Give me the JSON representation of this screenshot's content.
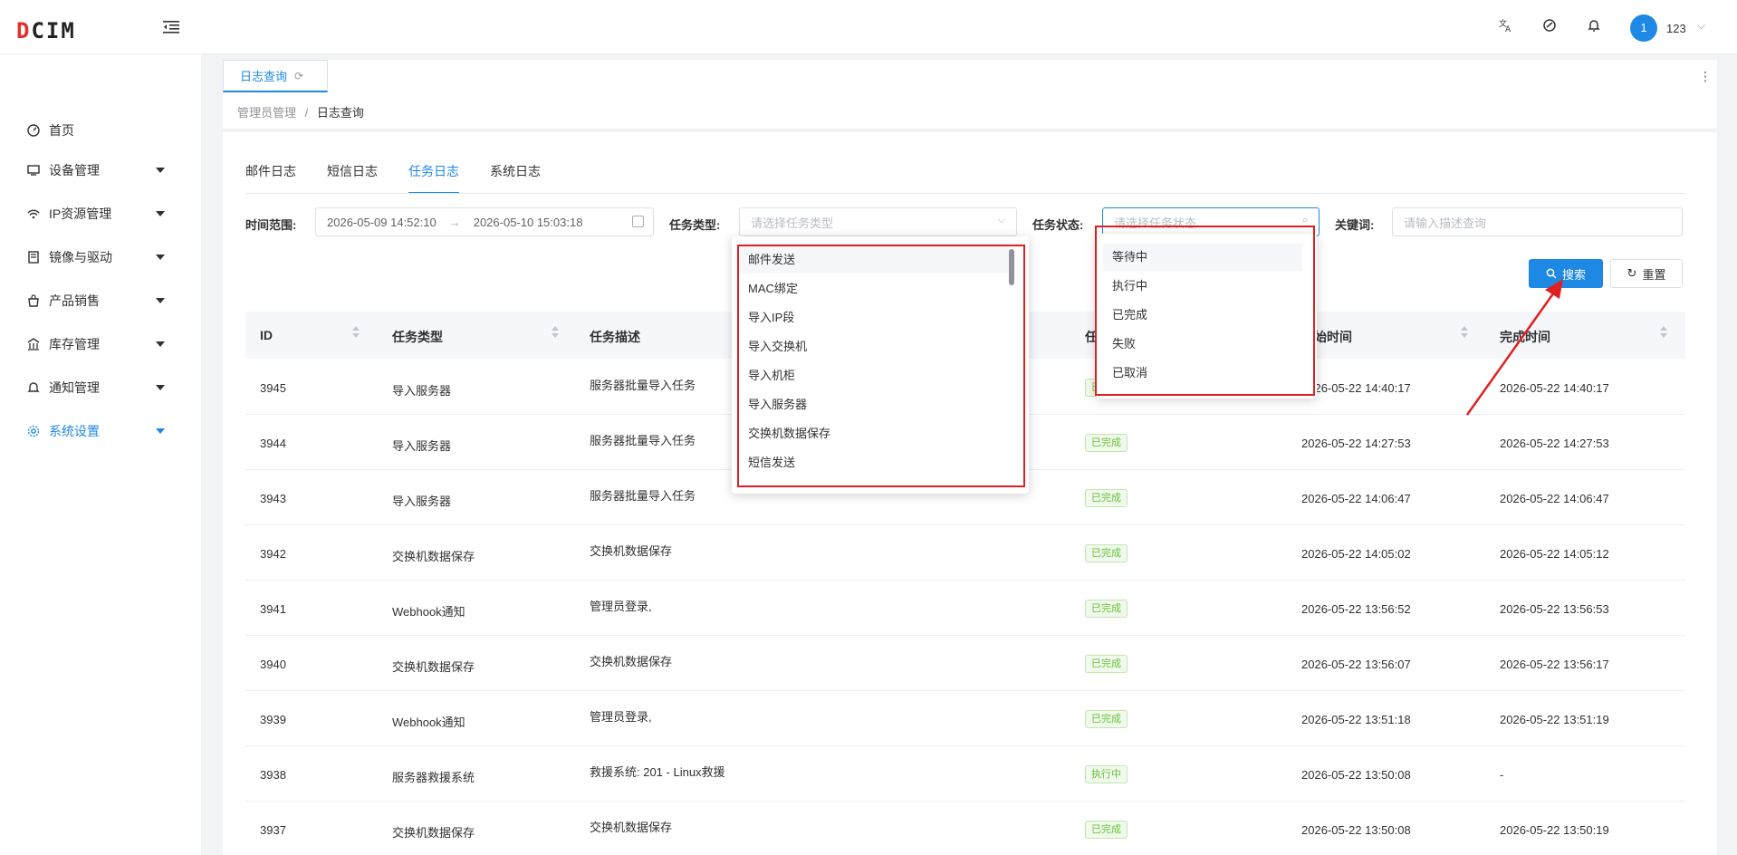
{
  "header": {
    "logo": "DCIM",
    "username": "123",
    "avatar": "1",
    "icons": [
      "translate-icon",
      "theme-icon",
      "bell-icon"
    ]
  },
  "sidebar": {
    "items": [
      {
        "label": "首页",
        "icon": "dashboard-icon"
      },
      {
        "label": "设备管理",
        "icon": "monitor-icon"
      },
      {
        "label": "IP资源管理",
        "icon": "network-icon"
      },
      {
        "label": "镜像与驱动",
        "icon": "disk-icon"
      },
      {
        "label": "产品销售",
        "icon": "cart-icon"
      },
      {
        "label": "库存管理",
        "icon": "warehouse-icon"
      },
      {
        "label": "通知管理",
        "icon": "bell-icon"
      },
      {
        "label": "系统设置",
        "icon": "gear-icon"
      }
    ]
  },
  "tabbar": {
    "active_tab": "日志查询"
  },
  "breadcrumb": {
    "parent": "管理员管理",
    "sep": "/",
    "current": "日志查询"
  },
  "subtabs": [
    "邮件日志",
    "短信日志",
    "任务日志",
    "系统日志"
  ],
  "filters": {
    "time_label": "时间范围:",
    "time_start": "2026-05-09 14:52:10",
    "time_arrow": "→",
    "time_end": "2026-05-10 15:03:18",
    "type_label": "任务类型:",
    "type_placeholder": "请选择任务类型",
    "status_label": "任务状态:",
    "status_placeholder": "请选择任务状态",
    "keyword_label": "关键词:",
    "keyword_placeholder": "请输入描述查询",
    "search": "搜索",
    "reset": "重置"
  },
  "table": {
    "headers": {
      "id": "ID",
      "type": "任务类型",
      "desc": "任务描述",
      "status": "任务状态",
      "start": "开始时间",
      "end": "完成时间"
    },
    "rows": [
      {
        "id": "3945",
        "type": "导入服务器",
        "desc": "服务器批量导入任务",
        "status": "已完成",
        "start": "2026-05-22 14:40:17",
        "end": "2026-05-22 14:40:17"
      },
      {
        "id": "3944",
        "type": "导入服务器",
        "desc": "服务器批量导入任务",
        "status": "已完成",
        "start": "2026-05-22 14:27:53",
        "end": "2026-05-22 14:27:53"
      },
      {
        "id": "3943",
        "type": "导入服务器",
        "desc": "服务器批量导入任务",
        "status": "已完成",
        "start": "2026-05-22 14:06:47",
        "end": "2026-05-22 14:06:47"
      },
      {
        "id": "3942",
        "type": "交换机数据保存",
        "desc": "交换机数据保存",
        "status": "已完成",
        "start": "2026-05-22 14:05:02",
        "end": "2026-05-22 14:05:12"
      },
      {
        "id": "3941",
        "type": "Webhook通知",
        "desc": "管理员登录,",
        "status": "已完成",
        "start": "2026-05-22 13:56:52",
        "end": "2026-05-22 13:56:53"
      },
      {
        "id": "3940",
        "type": "交换机数据保存",
        "desc": "交换机数据保存",
        "status": "已完成",
        "start": "2026-05-22 13:56:07",
        "end": "2026-05-22 13:56:17"
      },
      {
        "id": "3939",
        "type": "Webhook通知",
        "desc": "管理员登录,",
        "status": "已完成",
        "start": "2026-05-22 13:51:18",
        "end": "2026-05-22 13:51:19"
      },
      {
        "id": "3938",
        "type": "服务器救援系统",
        "desc": "救援系统: 201 - Linux救援",
        "status": "执行中",
        "start": "2026-05-22 13:50:08",
        "end": "-"
      },
      {
        "id": "3937",
        "type": "交换机数据保存",
        "desc": "交换机数据保存",
        "status": "已完成",
        "start": "2026-05-22 13:50:08",
        "end": "2026-05-22 13:50:19"
      }
    ]
  },
  "type_dropdown": [
    "邮件发送",
    "MAC绑定",
    "导入IP段",
    "导入交换机",
    "导入机柜",
    "导入服务器",
    "交换机数据保存",
    "短信发送"
  ],
  "status_dropdown": [
    "等待中",
    "执行中",
    "已完成",
    "失败",
    "已取消"
  ],
  "colors": {
    "accent": "#1e88e5",
    "annotation": "#e02020",
    "success": "#67c23a"
  }
}
